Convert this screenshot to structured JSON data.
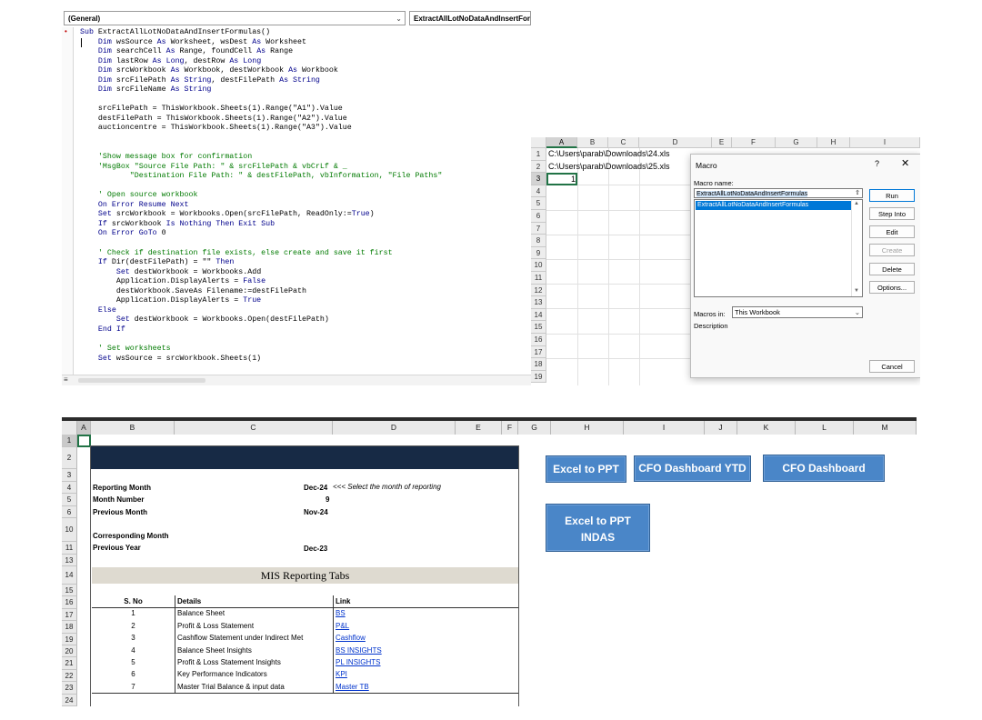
{
  "vba": {
    "procedure_dropdown": "(General)",
    "object_dropdown": "ExtractAllLotNoDataAndInsertFormu"
  },
  "excel_top": {
    "columns": [
      "A",
      "B",
      "C",
      "D",
      "E",
      "F",
      "G",
      "H",
      "I"
    ],
    "rows": [
      "1",
      "2",
      "3",
      "4",
      "5",
      "6",
      "7",
      "8",
      "9",
      "10",
      "11",
      "12",
      "13",
      "14",
      "15",
      "16",
      "17",
      "18",
      "19"
    ],
    "a1": "C:\\Users\\parab\\Downloads\\24.xls",
    "a2": "C:\\Users\\parab\\Downloads\\25.xls",
    "a3": "1"
  },
  "macro_dialog": {
    "title": "Macro",
    "help": "?",
    "close": "✕",
    "macro_name_label": "Macro name:",
    "macro_name_value": "ExtractAllLotNoDataAndInsertFormulas",
    "list_items": [
      "ExtractAllLotNoDataAndInsertFormulas"
    ],
    "buttons": {
      "run": "Run",
      "step_into": "Step Into",
      "edit": "Edit",
      "create": "Create",
      "delete": "Delete",
      "options": "Options...",
      "cancel": "Cancel"
    },
    "macros_in_label": "Macros in:",
    "macros_in_value": "This Workbook",
    "description_label": "Description"
  },
  "excel_bottom": {
    "columns": [
      "A",
      "B",
      "C",
      "D",
      "E",
      "F",
      "G",
      "H",
      "I",
      "J",
      "K",
      "L",
      "M"
    ],
    "rows": [
      "1",
      "2",
      "3",
      "4",
      "5",
      "6",
      "10",
      "11",
      "13",
      "14",
      "15",
      "16",
      "17",
      "18",
      "19",
      "20",
      "21",
      "22",
      "23",
      "24"
    ],
    "reporting_month_label": "Reporting Month",
    "reporting_month_value": "Dec-24",
    "reporting_month_note": "<<< Select the month of reporting",
    "month_number_label": "Month Number",
    "month_number_value": "9",
    "previous_month_label": "Previous Month",
    "previous_month_value": "Nov-24",
    "corresponding_month_label": "Corresponding Month",
    "previous_year_label": "Previous Year",
    "previous_year_value": "Dec-23",
    "tabs_title": "MIS Reporting Tabs",
    "table_headers": {
      "sno": "S. No",
      "details": "Details",
      "link": "Link"
    },
    "table_rows": [
      {
        "sno": "1",
        "details": "Balance Sheet",
        "link": "BS"
      },
      {
        "sno": "2",
        "details": "Profit & Loss Statement",
        "link": "P&L"
      },
      {
        "sno": "3",
        "details": "Cashflow Statement under Indirect Met",
        "link": "Cashflow"
      },
      {
        "sno": "4",
        "details": "Balance Sheet Insights",
        "link": "BS INSIGHTS"
      },
      {
        "sno": "5",
        "details": "Profit & Loss Statement Insights",
        "link": "PL INSIGHTS"
      },
      {
        "sno": "6",
        "details": "Key Performance Indicators",
        "link": "KPI"
      },
      {
        "sno": "7",
        "details": "Master Trial Balance & input data",
        "link": "Master TB"
      }
    ],
    "buttons": {
      "excel_to_ppt": "Excel to PPT",
      "cfo_dashboard_ytd": "CFO Dashboard YTD",
      "cfo_dashboard": "CFO Dashboard",
      "excel_to_ppt_indas_line1": "Excel to PPT",
      "excel_to_ppt_indas_line2": "INDAS"
    }
  }
}
